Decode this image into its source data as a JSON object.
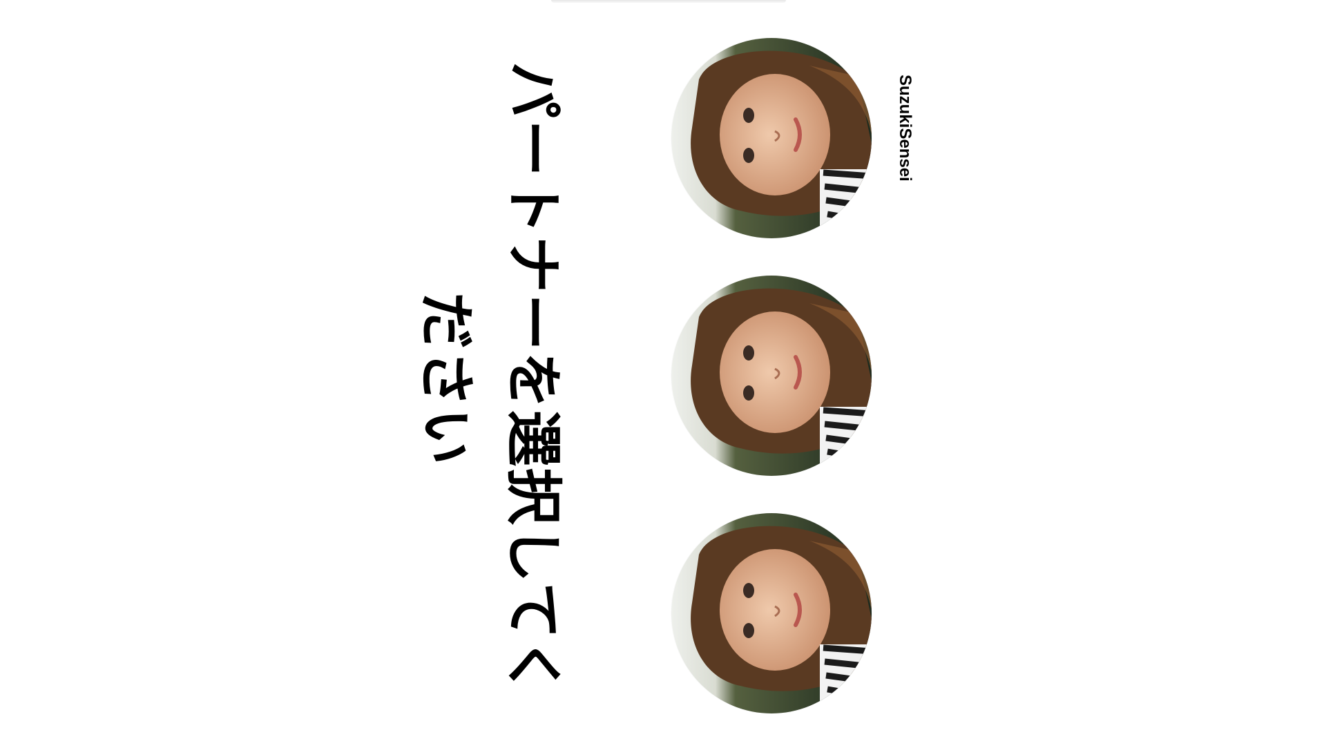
{
  "heading": "パートナーを選択してください",
  "partners": [
    {
      "name": "SuzukiSensei",
      "photo_icon": "portrait-photo"
    },
    {
      "name": "",
      "photo_icon": "portrait-photo"
    },
    {
      "name": "",
      "photo_icon": "portrait-photo"
    }
  ]
}
